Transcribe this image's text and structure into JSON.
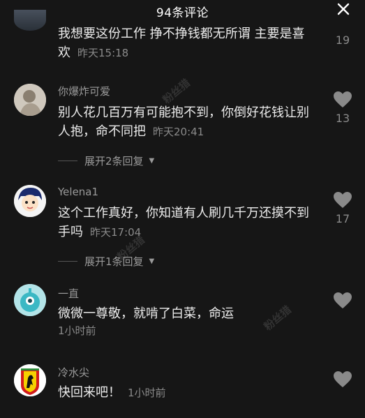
{
  "header": {
    "title": "94条评论"
  },
  "comments": [
    {
      "username": "",
      "text": "我想要这份工作 挣不挣钱都无所谓 主要是喜欢",
      "time": "昨天15:18",
      "likes": "19"
    },
    {
      "username": "你爆炸可爱",
      "text": "别人花几百万有可能抱不到，你倒好花钱让别人抱，命不同把",
      "time": "昨天20:41",
      "likes": "13",
      "expand": "展开2条回复"
    },
    {
      "username": "Yelena1",
      "text": "这个工作真好，你知道有人刷几千万还摸不到手吗",
      "time": "昨天17:04",
      "likes": "17",
      "expand": "展开1条回复"
    },
    {
      "username": "一直",
      "text": "微微一尊敬，就啃了白菜，命运",
      "time": "1小时前",
      "likes": ""
    },
    {
      "username": "冷水尖",
      "text": "快回来吧！",
      "time": "1小时前",
      "likes": ""
    }
  ],
  "watermark": "粉丝猎",
  "colors": {
    "background": "#161616",
    "text": "#ececec",
    "muted": "#8a8a8a",
    "heart": "#8a8a8a"
  }
}
